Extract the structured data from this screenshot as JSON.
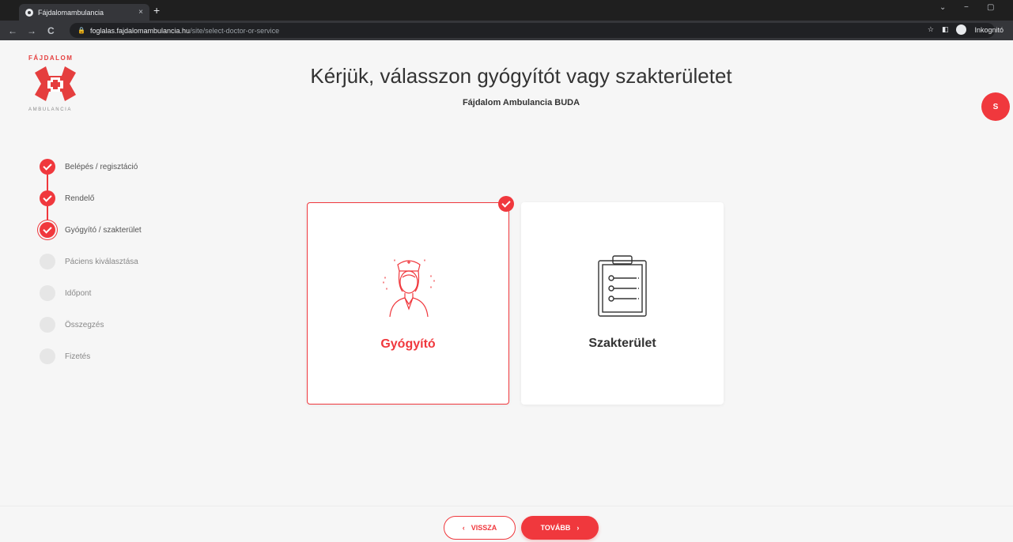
{
  "browser": {
    "tab_title": "Fájdalomambulancia",
    "tab_close": "×",
    "new_tab": "+",
    "url_host": "foglalas.fajdalomambulancia.hu",
    "url_path": "/site/select-doctor-or-service",
    "incognito_label": "Inkognitó",
    "back": "←",
    "forward": "→",
    "reload": "C",
    "lock": "🔒",
    "star": "☆",
    "sidebar_toggle": "◧",
    "win_down": "⌄",
    "win_min": "−",
    "win_restore": "▢"
  },
  "brand": {
    "top": "FÁJDALOM",
    "bottom": "AMBULANCIA",
    "color": "#f0383d"
  },
  "header": {
    "title": "Kérjük, válasszon gyógyítót vagy szakterületet",
    "subtitle": "Fájdalom Ambulancia BUDA"
  },
  "user": {
    "avatar_initial": "S"
  },
  "steps": [
    {
      "label": "Belépés / regisztáció",
      "state": "done"
    },
    {
      "label": "Rendelő",
      "state": "done"
    },
    {
      "label": "Gyógyító / szakterület",
      "state": "current"
    },
    {
      "label": "Páciens kiválasztása",
      "state": "pending"
    },
    {
      "label": "Időpont",
      "state": "pending"
    },
    {
      "label": "Összegzés",
      "state": "pending"
    },
    {
      "label": "Fizetés",
      "state": "pending"
    }
  ],
  "options": [
    {
      "label": "Gyógyító",
      "icon": "nurse-icon",
      "selected": true
    },
    {
      "label": "Szakterület",
      "icon": "clipboard-icon",
      "selected": false
    }
  ],
  "footer": {
    "back_label": "VISSZA",
    "back_arrow": "‹",
    "next_label": "TOVÁBB",
    "next_arrow": "›"
  }
}
